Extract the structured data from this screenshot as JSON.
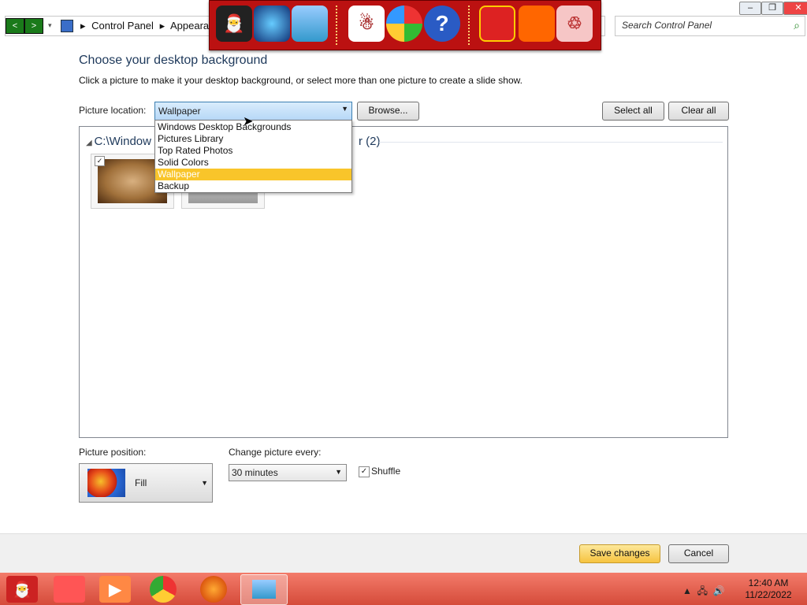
{
  "window": {
    "breadcrumb": [
      "Control Panel",
      "Appearanc"
    ],
    "search_placeholder": "Search Control Panel",
    "nav_back": "<",
    "nav_forward": ">"
  },
  "dock_icons": [
    "santa-hat-icon",
    "globe-icon",
    "network-icon",
    "snowman-icon",
    "windows-orb-icon",
    "help-icon",
    "gift-icon",
    "folder-icon",
    "recycle-bin-icon"
  ],
  "content": {
    "title": "Choose your desktop background",
    "description": "Click a picture to make it your desktop background, or select more than one picture to create a slide show.",
    "picture_location_label": "Picture location:",
    "picture_location_value": "Wallpaper",
    "browse_label": "Browse...",
    "select_all_label": "Select all",
    "clear_all_label": "Clear all",
    "group_header": "C:\\Window",
    "group_count": "r (2)",
    "dropdown_options": [
      "Windows Desktop Backgrounds",
      "Pictures Library",
      "Top Rated Photos",
      "Solid Colors",
      "Wallpaper",
      "Backup"
    ],
    "dropdown_selected": "Wallpaper",
    "picture_position_label": "Picture position:",
    "picture_position_value": "Fill",
    "change_picture_label": "Change picture every:",
    "change_picture_value": "30 minutes",
    "shuffle_label": "Shuffle",
    "shuffle_checked": true,
    "save_label": "Save changes",
    "cancel_label": "Cancel"
  },
  "taskbar": {
    "icons": [
      "santa-icon",
      "folder-icon",
      "media-player-icon",
      "chrome-icon",
      "firefox-icon",
      "control-panel-icon"
    ],
    "time": "12:40 AM",
    "date": "11/22/2022"
  },
  "colors": {
    "dock": "#b11111",
    "taskbar": "#e0604f",
    "highlight": "#f9c52a",
    "title": "#1e395b"
  }
}
